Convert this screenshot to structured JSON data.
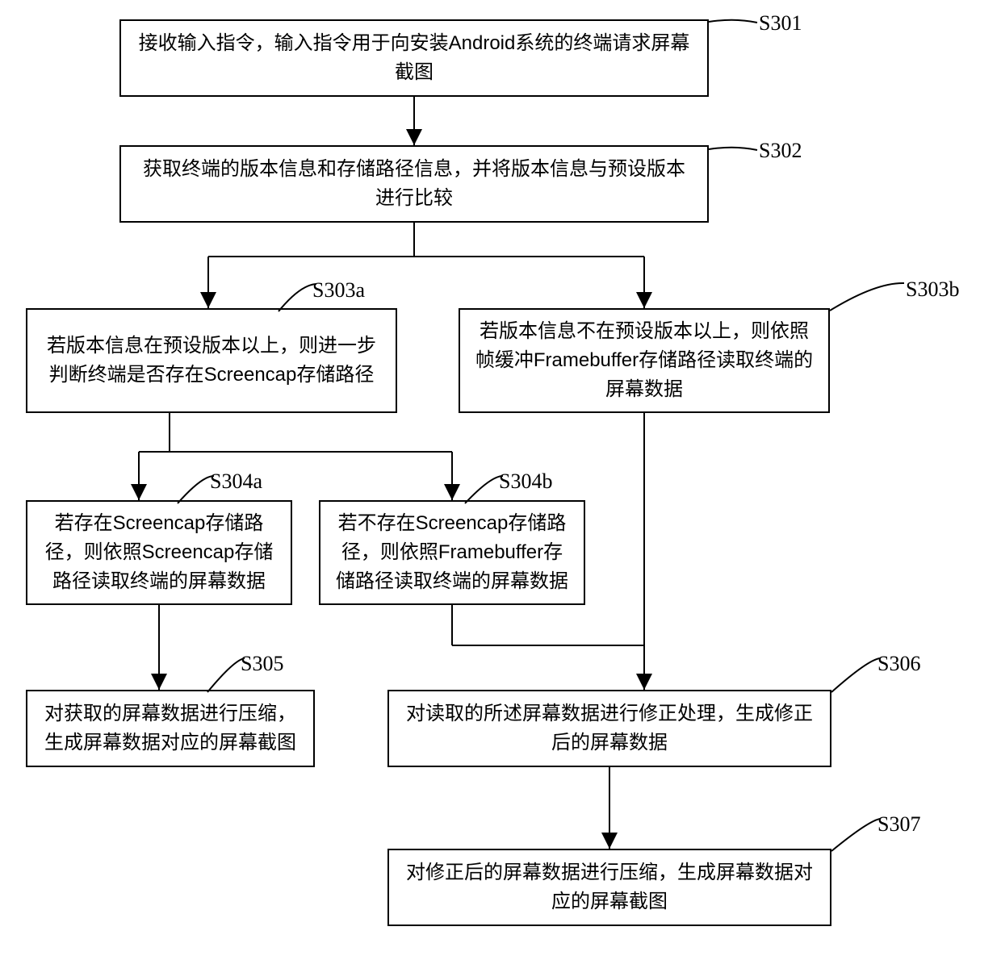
{
  "steps": {
    "s301": {
      "label": "S301",
      "text": "接收输入指令，输入指令用于向安装Android系统的终端请求屏幕截图"
    },
    "s302": {
      "label": "S302",
      "text": "获取终端的版本信息和存储路径信息，并将版本信息与预设版本进行比较"
    },
    "s303a": {
      "label": "S303a",
      "text": "若版本信息在预设版本以上，则进一步判断终端是否存在Screencap存储路径"
    },
    "s303b": {
      "label": "S303b",
      "text": "若版本信息不在预设版本以上，则依照帧缓冲Framebuffer存储路径读取终端的屏幕数据"
    },
    "s304a": {
      "label": "S304a",
      "text": "若存在Screencap存储路径，则依照Screencap存储路径读取终端的屏幕数据"
    },
    "s304b": {
      "label": "S304b",
      "text": "若不存在Screencap存储路径，则依照Framebuffer存储路径读取终端的屏幕数据"
    },
    "s305": {
      "label": "S305",
      "text": "对获取的屏幕数据进行压缩，生成屏幕数据对应的屏幕截图"
    },
    "s306": {
      "label": "S306",
      "text": "对读取的所述屏幕数据进行修正处理，生成修正后的屏幕数据"
    },
    "s307": {
      "label": "S307",
      "text": "对修正后的屏幕数据进行压缩，生成屏幕数据对应的屏幕截图"
    }
  }
}
